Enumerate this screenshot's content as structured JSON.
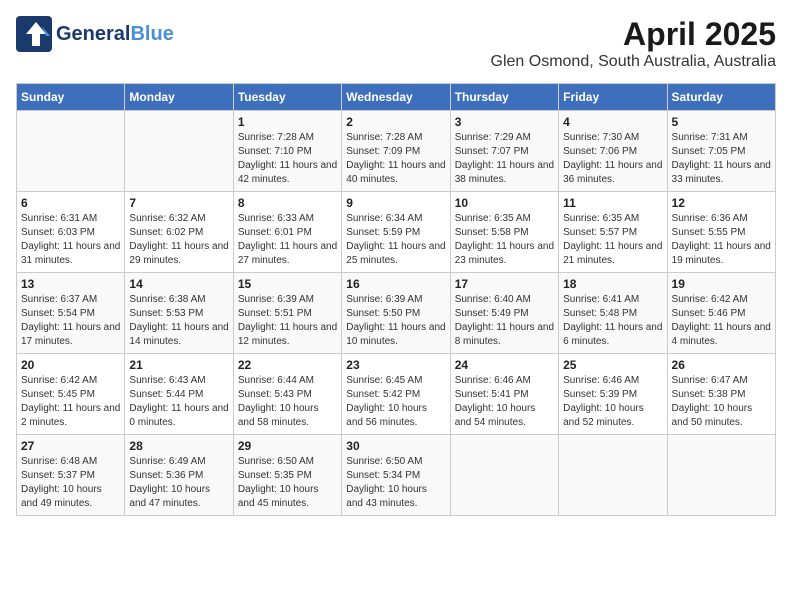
{
  "header": {
    "logo_line1": "General",
    "logo_line1_colored": "Blue",
    "title": "April 2025",
    "subtitle": "Glen Osmond, South Australia, Australia"
  },
  "days_of_week": [
    "Sunday",
    "Monday",
    "Tuesday",
    "Wednesday",
    "Thursday",
    "Friday",
    "Saturday"
  ],
  "weeks": [
    [
      {
        "day": "",
        "info": ""
      },
      {
        "day": "",
        "info": ""
      },
      {
        "day": "1",
        "info": "Sunrise: 7:28 AM\nSunset: 7:10 PM\nDaylight: 11 hours and 42 minutes."
      },
      {
        "day": "2",
        "info": "Sunrise: 7:28 AM\nSunset: 7:09 PM\nDaylight: 11 hours and 40 minutes."
      },
      {
        "day": "3",
        "info": "Sunrise: 7:29 AM\nSunset: 7:07 PM\nDaylight: 11 hours and 38 minutes."
      },
      {
        "day": "4",
        "info": "Sunrise: 7:30 AM\nSunset: 7:06 PM\nDaylight: 11 hours and 36 minutes."
      },
      {
        "day": "5",
        "info": "Sunrise: 7:31 AM\nSunset: 7:05 PM\nDaylight: 11 hours and 33 minutes."
      }
    ],
    [
      {
        "day": "6",
        "info": "Sunrise: 6:31 AM\nSunset: 6:03 PM\nDaylight: 11 hours and 31 minutes."
      },
      {
        "day": "7",
        "info": "Sunrise: 6:32 AM\nSunset: 6:02 PM\nDaylight: 11 hours and 29 minutes."
      },
      {
        "day": "8",
        "info": "Sunrise: 6:33 AM\nSunset: 6:01 PM\nDaylight: 11 hours and 27 minutes."
      },
      {
        "day": "9",
        "info": "Sunrise: 6:34 AM\nSunset: 5:59 PM\nDaylight: 11 hours and 25 minutes."
      },
      {
        "day": "10",
        "info": "Sunrise: 6:35 AM\nSunset: 5:58 PM\nDaylight: 11 hours and 23 minutes."
      },
      {
        "day": "11",
        "info": "Sunrise: 6:35 AM\nSunset: 5:57 PM\nDaylight: 11 hours and 21 minutes."
      },
      {
        "day": "12",
        "info": "Sunrise: 6:36 AM\nSunset: 5:55 PM\nDaylight: 11 hours and 19 minutes."
      }
    ],
    [
      {
        "day": "13",
        "info": "Sunrise: 6:37 AM\nSunset: 5:54 PM\nDaylight: 11 hours and 17 minutes."
      },
      {
        "day": "14",
        "info": "Sunrise: 6:38 AM\nSunset: 5:53 PM\nDaylight: 11 hours and 14 minutes."
      },
      {
        "day": "15",
        "info": "Sunrise: 6:39 AM\nSunset: 5:51 PM\nDaylight: 11 hours and 12 minutes."
      },
      {
        "day": "16",
        "info": "Sunrise: 6:39 AM\nSunset: 5:50 PM\nDaylight: 11 hours and 10 minutes."
      },
      {
        "day": "17",
        "info": "Sunrise: 6:40 AM\nSunset: 5:49 PM\nDaylight: 11 hours and 8 minutes."
      },
      {
        "day": "18",
        "info": "Sunrise: 6:41 AM\nSunset: 5:48 PM\nDaylight: 11 hours and 6 minutes."
      },
      {
        "day": "19",
        "info": "Sunrise: 6:42 AM\nSunset: 5:46 PM\nDaylight: 11 hours and 4 minutes."
      }
    ],
    [
      {
        "day": "20",
        "info": "Sunrise: 6:42 AM\nSunset: 5:45 PM\nDaylight: 11 hours and 2 minutes."
      },
      {
        "day": "21",
        "info": "Sunrise: 6:43 AM\nSunset: 5:44 PM\nDaylight: 11 hours and 0 minutes."
      },
      {
        "day": "22",
        "info": "Sunrise: 6:44 AM\nSunset: 5:43 PM\nDaylight: 10 hours and 58 minutes."
      },
      {
        "day": "23",
        "info": "Sunrise: 6:45 AM\nSunset: 5:42 PM\nDaylight: 10 hours and 56 minutes."
      },
      {
        "day": "24",
        "info": "Sunrise: 6:46 AM\nSunset: 5:41 PM\nDaylight: 10 hours and 54 minutes."
      },
      {
        "day": "25",
        "info": "Sunrise: 6:46 AM\nSunset: 5:39 PM\nDaylight: 10 hours and 52 minutes."
      },
      {
        "day": "26",
        "info": "Sunrise: 6:47 AM\nSunset: 5:38 PM\nDaylight: 10 hours and 50 minutes."
      }
    ],
    [
      {
        "day": "27",
        "info": "Sunrise: 6:48 AM\nSunset: 5:37 PM\nDaylight: 10 hours and 49 minutes."
      },
      {
        "day": "28",
        "info": "Sunrise: 6:49 AM\nSunset: 5:36 PM\nDaylight: 10 hours and 47 minutes."
      },
      {
        "day": "29",
        "info": "Sunrise: 6:50 AM\nSunset: 5:35 PM\nDaylight: 10 hours and 45 minutes."
      },
      {
        "day": "30",
        "info": "Sunrise: 6:50 AM\nSunset: 5:34 PM\nDaylight: 10 hours and 43 minutes."
      },
      {
        "day": "",
        "info": ""
      },
      {
        "day": "",
        "info": ""
      },
      {
        "day": "",
        "info": ""
      }
    ]
  ]
}
